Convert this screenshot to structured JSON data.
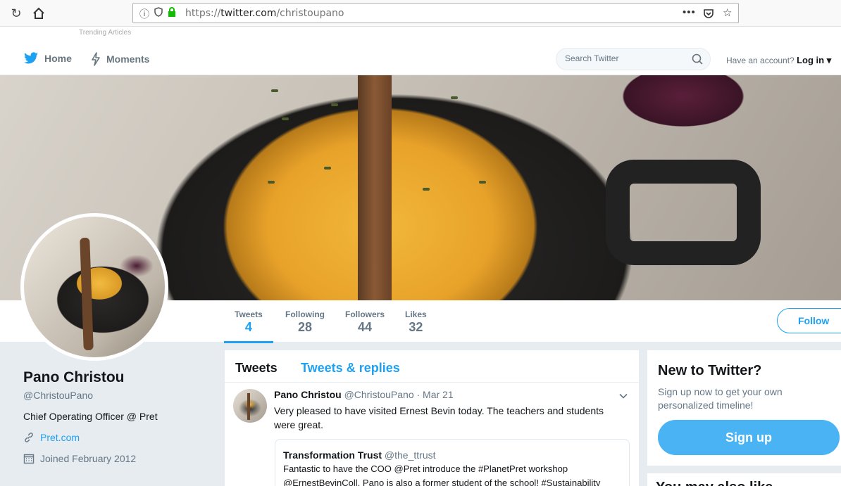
{
  "browser": {
    "url_prefix": "https://",
    "url_host": "twitter.com",
    "url_path": "/christoupano",
    "tab_hint": "Trending Articles",
    "more_glyph": "•••"
  },
  "header": {
    "home_label": "Home",
    "moments_label": "Moments",
    "search_placeholder": "Search Twitter",
    "have_account": "Have an account?",
    "login_label": "Log in"
  },
  "profile": {
    "name": "Pano Christou",
    "handle": "@ChristouPano",
    "bio": "Chief Operating Officer @ Pret",
    "website": "Pret.com",
    "joined": "Joined February 2012"
  },
  "stats": [
    {
      "label": "Tweets",
      "value": "4"
    },
    {
      "label": "Following",
      "value": "28"
    },
    {
      "label": "Followers",
      "value": "44"
    },
    {
      "label": "Likes",
      "value": "32"
    }
  ],
  "follow_label": "Follow",
  "timeline": {
    "tabs": [
      "Tweets",
      "Tweets & replies"
    ],
    "tweet": {
      "name": "Pano Christou",
      "handle": "@ChristouPano",
      "date": "· Mar 21",
      "text": "Very pleased to have visited Ernest Bevin today. The teachers and students were great.",
      "quote": {
        "name": "Transformation Trust",
        "handle": "@the_ttrust",
        "text": "Fantastic to have the COO @Pret introduce the #PlanetPret workshop @ErnestBevinColl. Pano is also a former student of the school! #Sustainability"
      }
    }
  },
  "signup": {
    "title": "New to Twitter?",
    "subtitle": "Sign up now to get your own personalized timeline!",
    "button": "Sign up"
  },
  "next_card_title": "You may also like",
  "colors": {
    "accent": "#1da1f2",
    "signup": "#4ab3f4",
    "muted": "#657786",
    "background": "#e6ecf0"
  }
}
